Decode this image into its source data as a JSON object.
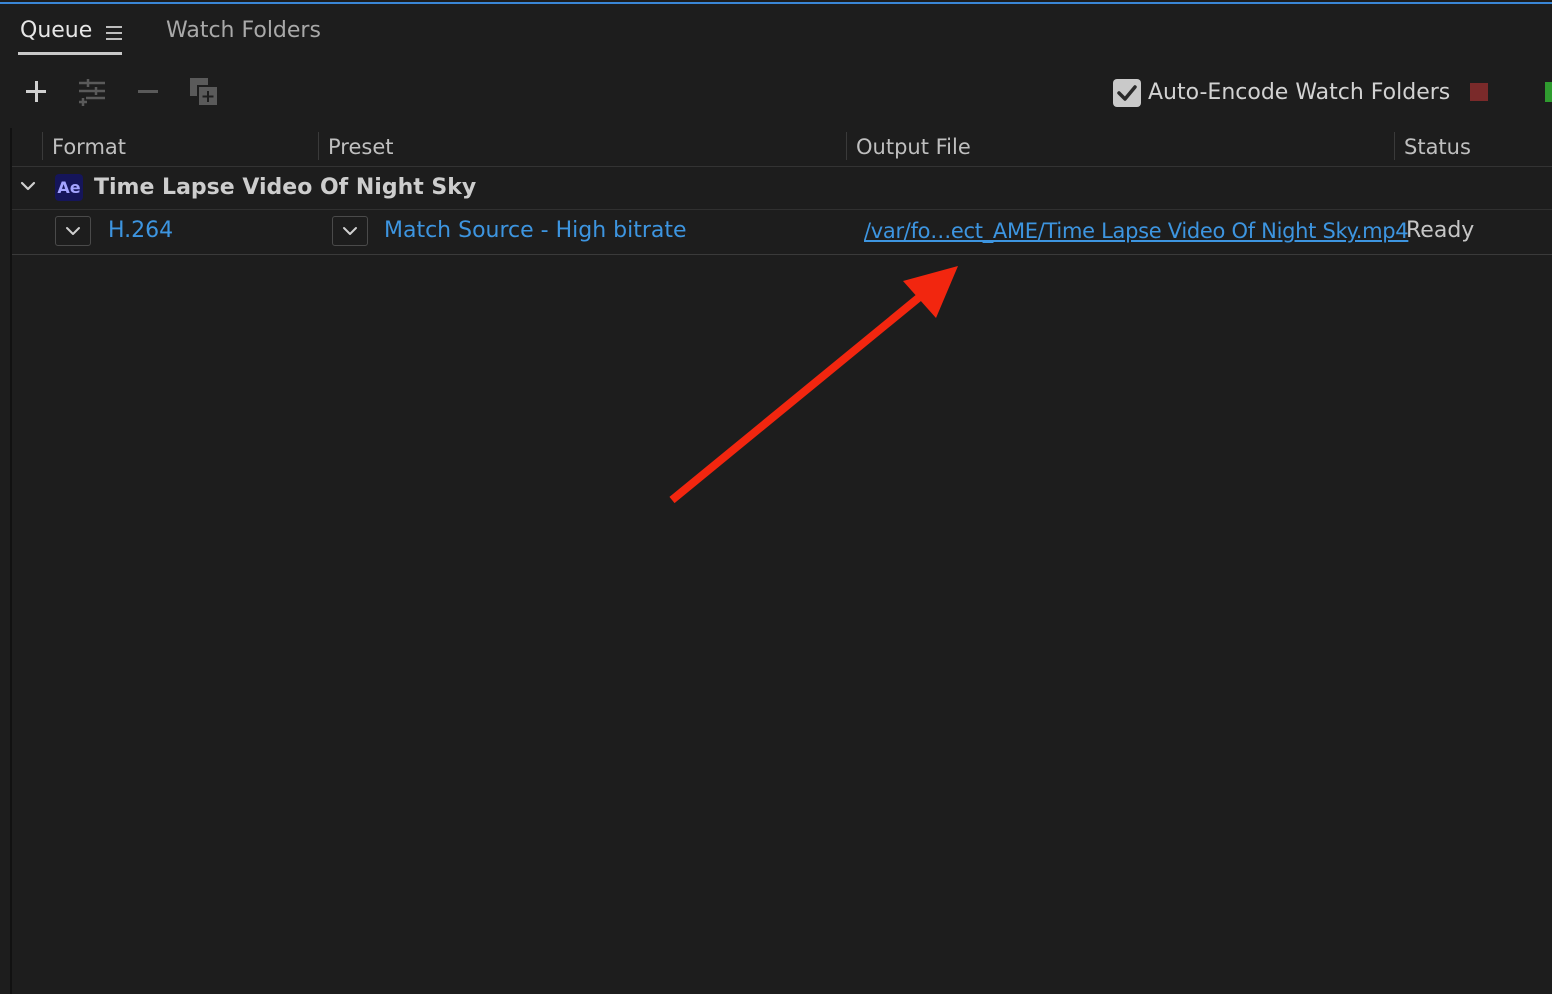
{
  "tabs": {
    "queue": "Queue",
    "watch_folders": "Watch Folders"
  },
  "toolbar": {
    "add_icon": "plus-icon",
    "settings_icon": "settings-sliders-icon",
    "remove_icon": "minus-icon",
    "duplicate_icon": "duplicate-icon",
    "auto_encode_label": "Auto-Encode Watch Folders",
    "auto_encode_checked": true,
    "stop_color": "#7a2a2a",
    "start_color": "#2f9b2f"
  },
  "columns": {
    "format": "Format",
    "preset": "Preset",
    "output_file": "Output File",
    "status": "Status"
  },
  "queue": {
    "group": {
      "app_badge": "Ae",
      "title": "Time Lapse Video Of Night Sky"
    },
    "items": [
      {
        "format": "H.264",
        "preset": "Match Source - High bitrate",
        "output_file": "/var/fo…ect_AME/Time Lapse Video Of Night Sky.mp4",
        "status": "Ready"
      }
    ]
  },
  "colors": {
    "accent": "#3a86d6",
    "link": "#3d95e0",
    "annotation_arrow": "#f2260f"
  }
}
